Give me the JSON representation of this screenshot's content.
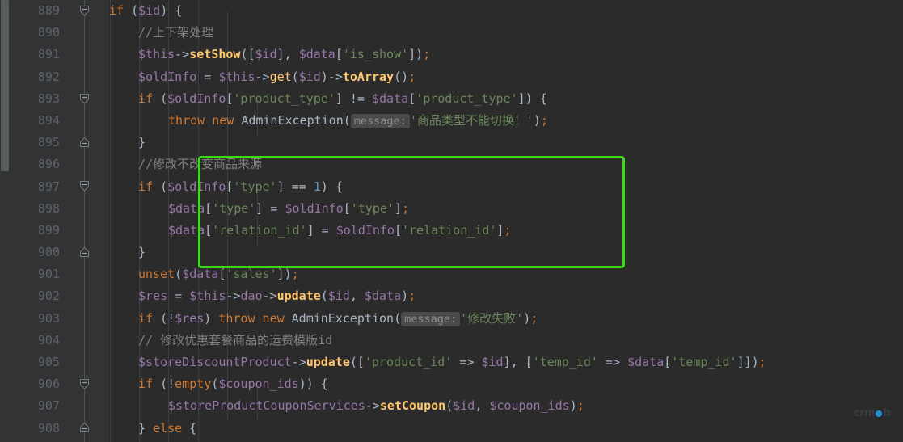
{
  "editor": {
    "app": "code-editor",
    "theme": "darcula",
    "language": "PHP",
    "colors": {
      "background": "#2b2b2b",
      "gutter_background": "#313335",
      "line_number": "#606366",
      "keyword": "#cc7832",
      "variable": "#9876aa",
      "function": "#ffc66d",
      "string": "#6a8759",
      "comment": "#808080",
      "number": "#6897bb",
      "default_text": "#a9b7c6",
      "highlight_box": "#3cdc14",
      "param_hint_bg": "#4a4a4a",
      "param_hint_text": "#8c8c8c",
      "scrollbar_thumb": "#5a5d5e"
    },
    "first_line_number": 889,
    "last_line_number": 908
  },
  "line_numbers": [
    "889",
    "890",
    "891",
    "892",
    "893",
    "894",
    "895",
    "896",
    "897",
    "898",
    "899",
    "900",
    "901",
    "902",
    "903",
    "904",
    "905",
    "906",
    "907",
    "908"
  ],
  "fold_markers": [
    {
      "line": "889",
      "type": "fold-collapse-down",
      "icon": "fold-minus-down-icon"
    },
    {
      "line": "893",
      "type": "fold-collapse-down",
      "icon": "fold-minus-down-icon"
    },
    {
      "line": "895",
      "type": "fold-collapse-up",
      "icon": "fold-minus-up-icon"
    },
    {
      "line": "897",
      "type": "fold-collapse-down",
      "icon": "fold-minus-down-icon"
    },
    {
      "line": "900",
      "type": "fold-collapse-up",
      "icon": "fold-minus-up-icon"
    },
    {
      "line": "906",
      "type": "fold-collapse-down",
      "icon": "fold-minus-down-icon"
    },
    {
      "line": "908",
      "type": "fold-collapse-up",
      "icon": "fold-minus-up-icon"
    }
  ],
  "code_lines": [
    {
      "num": "889",
      "text": "    if ($id) {"
    },
    {
      "num": "890",
      "text": "        //上下架处理"
    },
    {
      "num": "891",
      "text": "        $this->setShow([$id], $data['is_show']);"
    },
    {
      "num": "892",
      "text": "        $oldInfo = $this->get($id)->toArray();"
    },
    {
      "num": "893",
      "text": "        if ($oldInfo['product_type'] != $data['product_type']) {"
    },
    {
      "num": "894",
      "text": "            throw new AdminException( message: '商品类型不能切换！');"
    },
    {
      "num": "895",
      "text": "        }"
    },
    {
      "num": "896",
      "text": "        //修改不改变商品来源"
    },
    {
      "num": "897",
      "text": "        if ($oldInfo['type'] == 1) {"
    },
    {
      "num": "898",
      "text": "            $data['type'] = $oldInfo['type'];"
    },
    {
      "num": "899",
      "text": "            $data['relation_id'] = $oldInfo['relation_id'];"
    },
    {
      "num": "900",
      "text": "        }"
    },
    {
      "num": "901",
      "text": "        unset($data['sales']);"
    },
    {
      "num": "902",
      "text": "        $res = $this->dao->update($id, $data);"
    },
    {
      "num": "903",
      "text": "        if (!$res) throw new AdminException( message: '修改失败');"
    },
    {
      "num": "904",
      "text": "        // 修改优惠套餐商品的运费模版id"
    },
    {
      "num": "905",
      "text": "        $storeDiscountProduct->update(['product_id' => $id], ['temp_id' => $data['temp_id']]);"
    },
    {
      "num": "906",
      "text": "        if (!empty($coupon_ids)) {"
    },
    {
      "num": "907",
      "text": "            $storeProductCouponServices->setCoupon($id, $coupon_ids);"
    },
    {
      "num": "908",
      "text": "        } else {"
    }
  ],
  "param_hints": [
    {
      "line": "894",
      "label": "message:"
    },
    {
      "line": "903",
      "label": "message:"
    }
  ],
  "highlight_annotation": {
    "type": "rectangle",
    "color": "#3cdc14",
    "covers_lines": [
      "896",
      "897",
      "898",
      "899",
      "900"
    ],
    "description": "green rectangle highlighting the type/relation_id preservation block"
  },
  "watermark": {
    "text_left": "crm",
    "text_right": "b",
    "middle_letter": "e",
    "full": "crmeb",
    "dot_color": "#1e9ae0"
  }
}
